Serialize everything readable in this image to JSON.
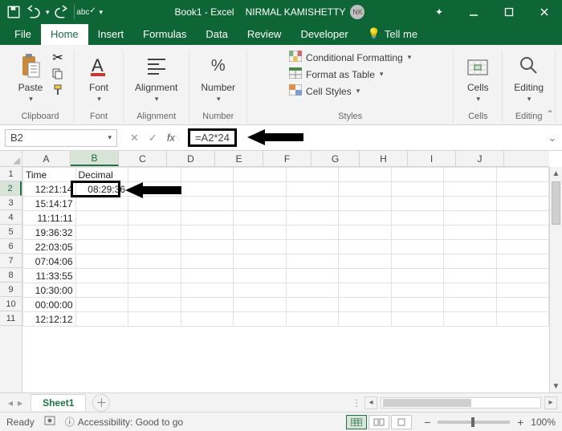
{
  "titlebar": {
    "doc": "Book1 - Excel",
    "user": "NIRMAL KAMISHETTY",
    "initials": "NK"
  },
  "tabs": [
    "File",
    "Home",
    "Insert",
    "Formulas",
    "Data",
    "Review",
    "Developer"
  ],
  "tellme": "Tell me",
  "ribbon": {
    "clipboard": {
      "paste": "Paste",
      "label": "Clipboard"
    },
    "font": {
      "label": "Font",
      "btn": "Font"
    },
    "alignment": {
      "label": "Alignment",
      "btn": "Alignment"
    },
    "number": {
      "label": "Number",
      "btn": "Number"
    },
    "styles": {
      "label": "Styles",
      "cond": "Conditional Formatting",
      "fmt": "Format as Table",
      "cell": "Cell Styles"
    },
    "cells": {
      "label": "Cells",
      "btn": "Cells"
    },
    "editing": {
      "label": "Editing",
      "btn": "Editing"
    }
  },
  "namebox": "B2",
  "formula": "=A2*24",
  "columns": [
    "A",
    "B",
    "C",
    "D",
    "E",
    "F",
    "G",
    "H",
    "I",
    "J"
  ],
  "rows": [
    "1",
    "2",
    "3",
    "4",
    "5",
    "6",
    "7",
    "8",
    "9",
    "10",
    "11"
  ],
  "selected_col": "B",
  "selected_row": "2",
  "sheet_data": {
    "headers": [
      "Time",
      "Decimal"
    ],
    "colA": [
      "12:21:14",
      "15:14:17",
      "11:11:11",
      "19:36:32",
      "22:03:05",
      "07:04:06",
      "11:33:55",
      "10:30:00",
      "00:00:00",
      "12:12:12"
    ],
    "B2": "08:29:36"
  },
  "sheet_tab": "Sheet1",
  "status": {
    "ready": "Ready",
    "acc": "Accessibility: Good to go",
    "zoom": "100%"
  }
}
